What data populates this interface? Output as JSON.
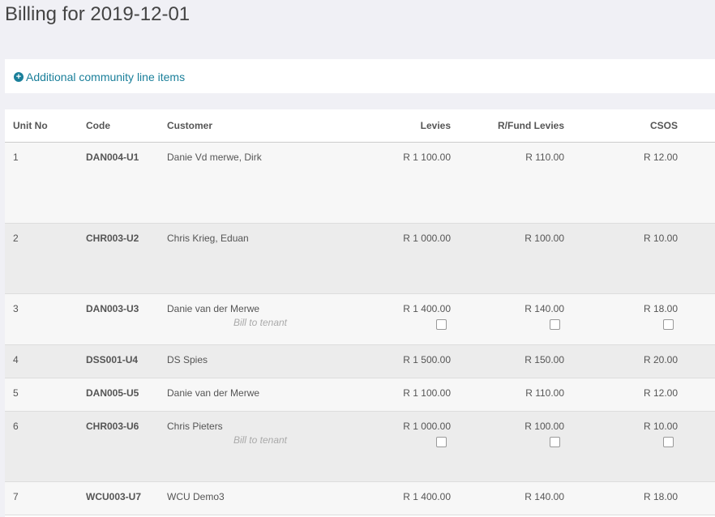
{
  "page": {
    "title": "Billing for 2019-12-01"
  },
  "additional": {
    "label": "Additional community line items"
  },
  "table": {
    "headers": {
      "unit": "Unit No",
      "code": "Code",
      "customer": "Customer",
      "levies": "Levies",
      "rfund": "R/Fund Levies",
      "csos": "CSOS"
    },
    "rows": [
      {
        "unit": "1",
        "code": "DAN004-U1",
        "customer": "Danie Vd merwe, Dirk",
        "levies": "R 1 100.00",
        "rfund": "R 110.00",
        "csos": "R 12.00"
      },
      {
        "unit": "2",
        "code": "CHR003-U2",
        "customer": "Chris Krieg, Eduan",
        "levies": "R 1 000.00",
        "rfund": "R 100.00",
        "csos": "R 10.00"
      },
      {
        "unit": "3",
        "code": "DAN003-U3",
        "customer": "Danie van der Merwe",
        "bill_to_tenant": "Bill to tenant",
        "levies": "R 1 400.00",
        "rfund": "R 140.00",
        "csos": "R 18.00"
      },
      {
        "unit": "4",
        "code": "DSS001-U4",
        "customer": "DS Spies",
        "levies": "R 1 500.00",
        "rfund": "R 150.00",
        "csos": "R 20.00"
      },
      {
        "unit": "5",
        "code": "DAN005-U5",
        "customer": "Danie van der Merwe",
        "levies": "R 1 100.00",
        "rfund": "R 110.00",
        "csos": "R 12.00"
      },
      {
        "unit": "6",
        "code": "CHR003-U6",
        "customer": "Chris Pieters",
        "bill_to_tenant": "Bill to tenant",
        "levies": "R 1 000.00",
        "rfund": "R 100.00",
        "csos": "R 10.00"
      },
      {
        "unit": "7",
        "code": "WCU003-U7",
        "customer": "WCU Demo3",
        "levies": "R 1 400.00",
        "rfund": "R 140.00",
        "csos": "R 18.00"
      }
    ]
  }
}
